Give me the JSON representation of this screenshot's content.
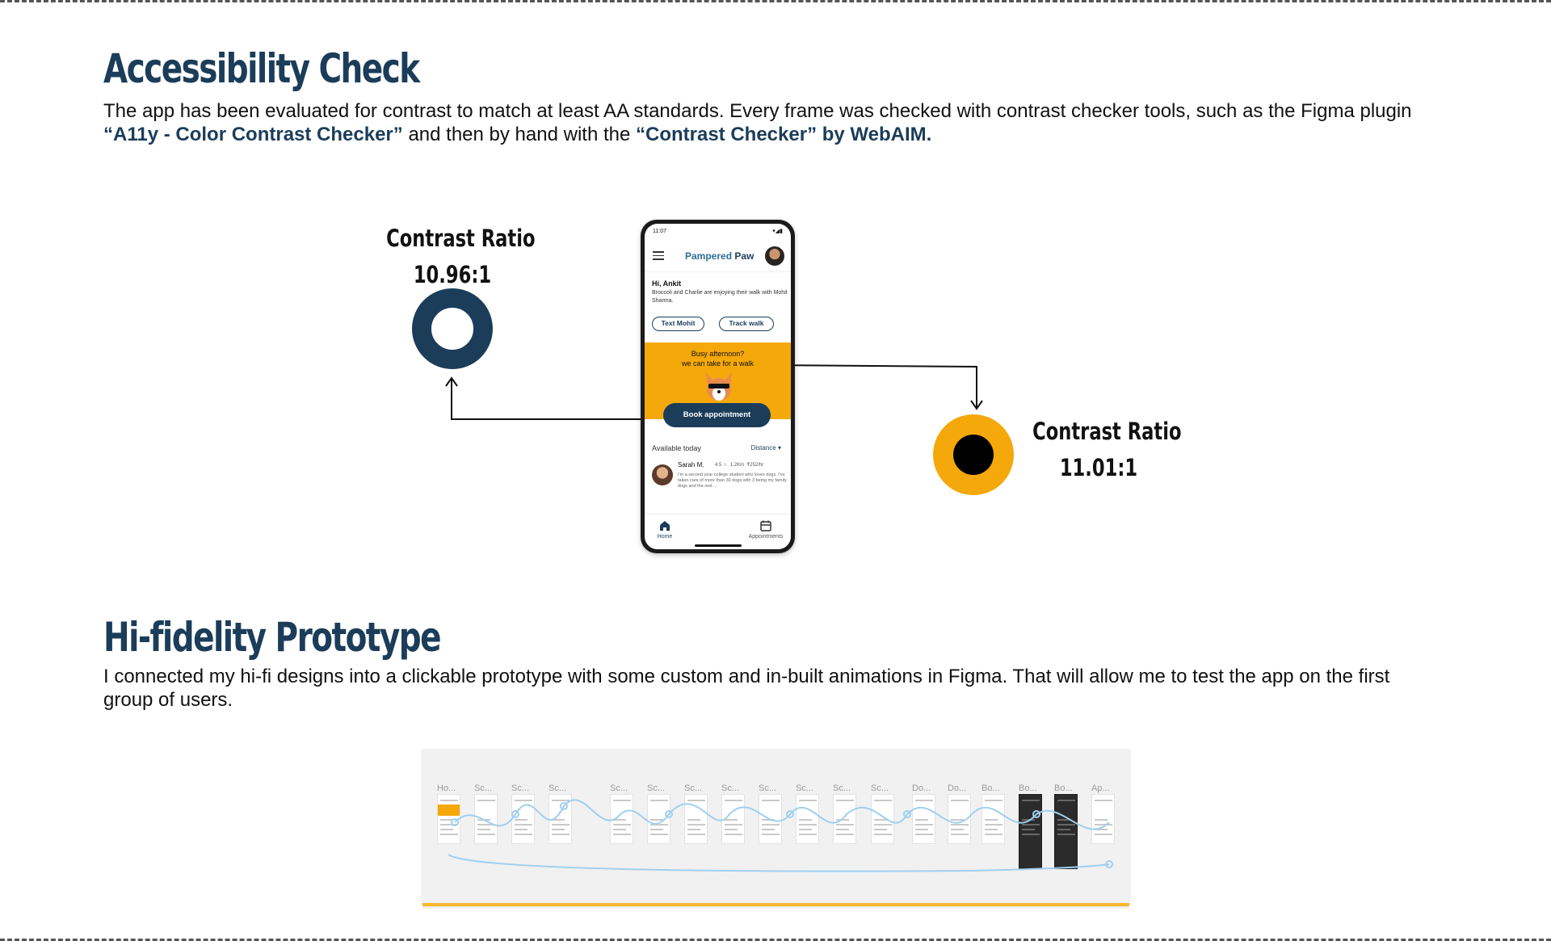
{
  "accessibility": {
    "title": "Accessibility Check",
    "desc_part1": " The app has been evaluated for contrast to match at least AA standards. Every frame was checked with contrast checker tools, such as the Figma plugin ",
    "link1": "“A11y - Color Contrast Checker”",
    "desc_part2": " and then by hand with the  ",
    "link2": "“Contrast Checker” by WebAIM."
  },
  "contrast_left": {
    "label": "Contrast Ratio",
    "ratio": "10.96:1",
    "color": "#1b3d5a"
  },
  "contrast_right": {
    "label": "Contrast Ratio",
    "ratio": "11.01:1",
    "color": "#f5a80a"
  },
  "phone": {
    "status_time": "11:07",
    "status_icons": "▾◢▮",
    "brand_part1": "Pampered",
    "brand_part2": " Paw",
    "greeting": "Hi, Ankit",
    "greeting_sub": "Broccoli and Charlie are enjoying their walk with Mohit Sharma.",
    "btn_text": "Text Mohit",
    "btn_track": "Track walk",
    "banner_line1": "Busy afternoon?",
    "banner_line2": "we can take for a walk",
    "book_button": "Book appointment",
    "available_label": "Available today",
    "sort_label": "Distance",
    "walker_name": "Sarah M.",
    "walker_rating": "4.5 ☆",
    "walker_distance": "1.2Km",
    "walker_price": "₹252/hr",
    "walker_desc": "I'm a second year college student who loves dogs. I've taken care of more than 30 dogs with 3 being my family dogs and the rest ...",
    "nav_home": "Home",
    "nav_appointments": "Appointments"
  },
  "prototype": {
    "title": "Hi-fidelity Prototype",
    "desc": "I connected my hi-fi designs into a clickable prototype with some custom and in-built animations in Figma. That will allow me to test the app on the first group of users.",
    "frame_labels": [
      "Ho...",
      "Sc...",
      "Sc...",
      "Sc...",
      "Sc...",
      "Sc...",
      "Sc...",
      "Sc...",
      "Sc...",
      "Sc...",
      "Sc...",
      "Sc...",
      "Do...",
      "Do...",
      "Bo...",
      "Bo...",
      "Bo...",
      "Ap..."
    ],
    "accent_color": "#f5b82e"
  }
}
